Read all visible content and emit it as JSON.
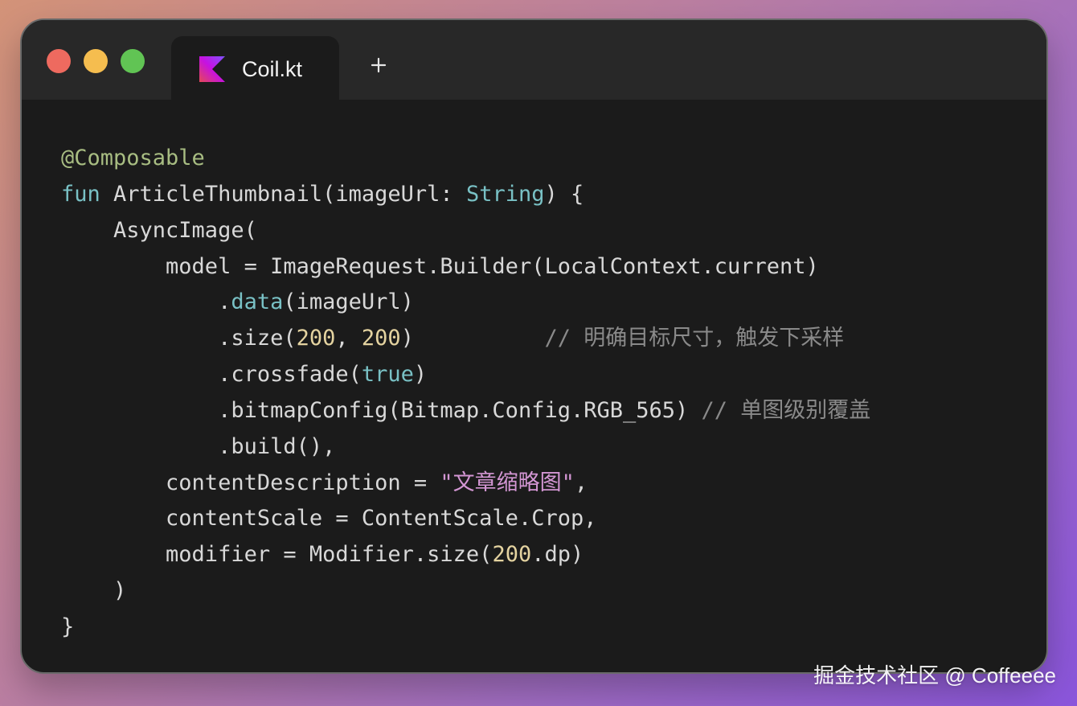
{
  "window": {
    "tab_title": "Coil.kt",
    "tab_icon": "kotlin-logo-icon",
    "add_tab_icon": "plus-icon",
    "traffic_lights": {
      "close": "#ee6a5f",
      "minimize": "#f5bd4f",
      "maximize": "#61c454"
    }
  },
  "code": {
    "lines": [
      [
        [
          "ann",
          "@Composable"
        ]
      ],
      [
        [
          "kw",
          "fun "
        ],
        [
          "",
          "ArticleThumbnail(imageUrl: "
        ],
        [
          "kw",
          "String"
        ],
        [
          "",
          ") {"
        ]
      ],
      [
        [
          "",
          "    AsyncImage("
        ]
      ],
      [
        [
          "",
          "        model = ImageRequest.Builder(LocalContext.current)"
        ]
      ],
      [
        [
          "",
          "            ."
        ],
        [
          "kw",
          "data"
        ],
        [
          "",
          "(imageUrl)"
        ]
      ],
      [
        [
          "",
          "            .size("
        ],
        [
          "num",
          "200"
        ],
        [
          "",
          ", "
        ],
        [
          "num",
          "200"
        ],
        [
          "",
          ")          "
        ],
        [
          "com",
          "// 明确目标尺寸，触发下采样"
        ]
      ],
      [
        [
          "",
          "            .crossfade("
        ],
        [
          "kw",
          "true"
        ],
        [
          "",
          ")"
        ]
      ],
      [
        [
          "",
          "            .bitmapConfig(Bitmap.Config.RGB_565) "
        ],
        [
          "com",
          "// 单图级别覆盖"
        ]
      ],
      [
        [
          "",
          "            .build(),"
        ]
      ],
      [
        [
          "",
          "        contentDescription = "
        ],
        [
          "str",
          "\"文章缩略图\""
        ],
        [
          "",
          ","
        ]
      ],
      [
        [
          "",
          "        contentScale = ContentScale.Crop,"
        ]
      ],
      [
        [
          "",
          "        modifier = Modifier.size("
        ],
        [
          "num",
          "200"
        ],
        [
          "",
          ".dp)"
        ]
      ],
      [
        [
          "",
          "    )"
        ]
      ],
      [
        [
          "",
          "}"
        ]
      ]
    ]
  },
  "watermark": "掘金技术社区 @ Coffeeee",
  "colors": {
    "window_bg": "#1b1b1b",
    "titlebar_bg": "#282828",
    "text": "#d8d8d8",
    "annotation": "#a8bd82",
    "keyword": "#79c1c5",
    "number": "#e4d3a0",
    "string": "#d396d3",
    "comment": "#8a8a8a"
  }
}
